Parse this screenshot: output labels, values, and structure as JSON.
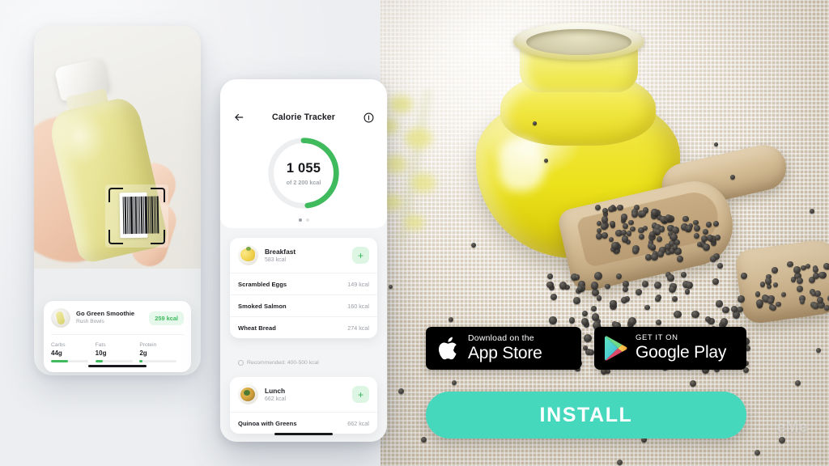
{
  "ad": {
    "install_label": "INSTALL",
    "install_color": "#45d8bd",
    "accent_green": "#3fba5d"
  },
  "store_badges": {
    "appstore": {
      "small": "Download on the",
      "big": "App Store",
      "icon": "apple-logo-icon"
    },
    "googleplay": {
      "small": "GET IT ON",
      "big": "Google Play",
      "icon": "google-play-triangle-icon"
    }
  },
  "photo": {
    "watermark": "eMe",
    "description_icons": [
      "oil-jar-icon",
      "wooden-scoop-icon",
      "black-seeds-icon"
    ]
  },
  "phone_scan": {
    "scanner": {
      "icon": "barcode-scan-frame-icon",
      "barcode": "barcode-icon"
    },
    "product_card": {
      "name": "Go Green Smoothie",
      "brand": "Rush Bowls",
      "calories_badge": "259 kcal",
      "macros": [
        {
          "label": "Carbs",
          "value": "44g",
          "fill_pct": 45
        },
        {
          "label": "Fats",
          "value": "10g",
          "fill_pct": 20
        },
        {
          "label": "Protein",
          "value": "2g",
          "fill_pct": 8
        }
      ]
    }
  },
  "phone_tracker": {
    "header": {
      "back_icon": "back-arrow-icon",
      "title": "Calorie Tracker",
      "info_icon": "info-icon"
    },
    "ring": {
      "value": "1 055",
      "subtitle": "of 2 200 kcal",
      "consumed": 1055,
      "goal": 2200,
      "percent": 48,
      "track_color": "#eceef0",
      "arc_color": "#3fba5d"
    },
    "pagination": {
      "total": 2,
      "active_index": 0
    },
    "meals": [
      {
        "name": "Breakfast",
        "calories": "583 kcal",
        "thumb_icon": "scrambled-eggs-icon",
        "add_icon": "plus-icon",
        "items": [
          {
            "name": "Scrambled Eggs",
            "calories": "149 kcal"
          },
          {
            "name": "Smoked Salmon",
            "calories": "160 kcal"
          },
          {
            "name": "Wheat Bread",
            "calories": "274 kcal"
          }
        ]
      },
      {
        "name": "Lunch",
        "calories": "662 kcal",
        "thumb_icon": "quinoa-bowl-icon",
        "add_icon": "plus-icon",
        "items": [
          {
            "name": "Quinoa with Greens",
            "calories": "662 kcal"
          }
        ]
      }
    ],
    "recommendation": "Recommended: 400-500 kcal"
  }
}
